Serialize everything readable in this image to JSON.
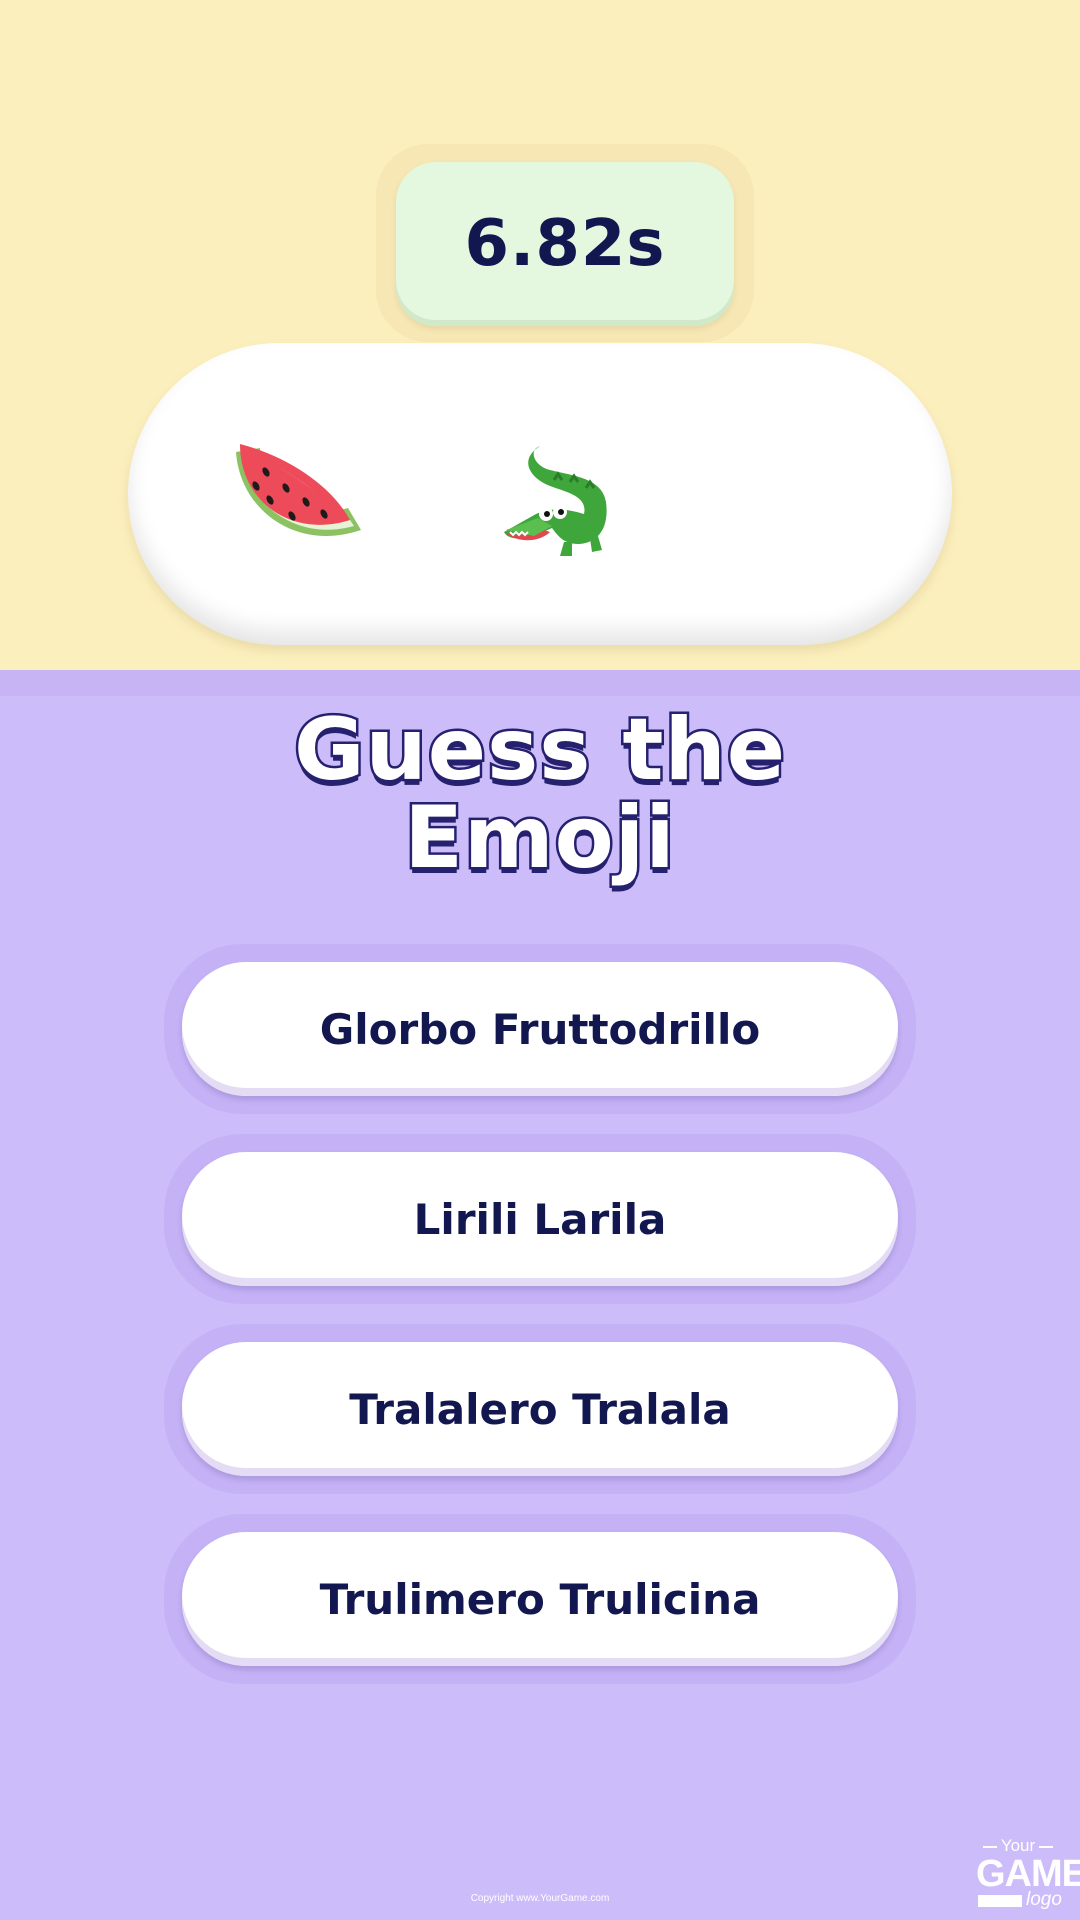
{
  "timer": {
    "value": "6.82s"
  },
  "puzzle": {
    "emojis": [
      "watermelon-icon",
      "crocodile-icon"
    ]
  },
  "title": {
    "line1": "Guess the",
    "line2": "Emoji"
  },
  "options": [
    "Glorbo Fruttodrillo",
    "Lirili Larila",
    "Tralalero Tralala",
    "Trulimero Trulicina"
  ],
  "footer": {
    "copyright": "Copyright www.YourGame.com",
    "logo": {
      "top": "Your",
      "main": "GAME",
      "sub": "logo"
    }
  },
  "colors": {
    "top_background": "#fbefbd",
    "bottom_background": "#cdbcfa",
    "timer_box": "#e4f8e0",
    "text_dark": "#12184f",
    "title_outline": "#25216f"
  }
}
